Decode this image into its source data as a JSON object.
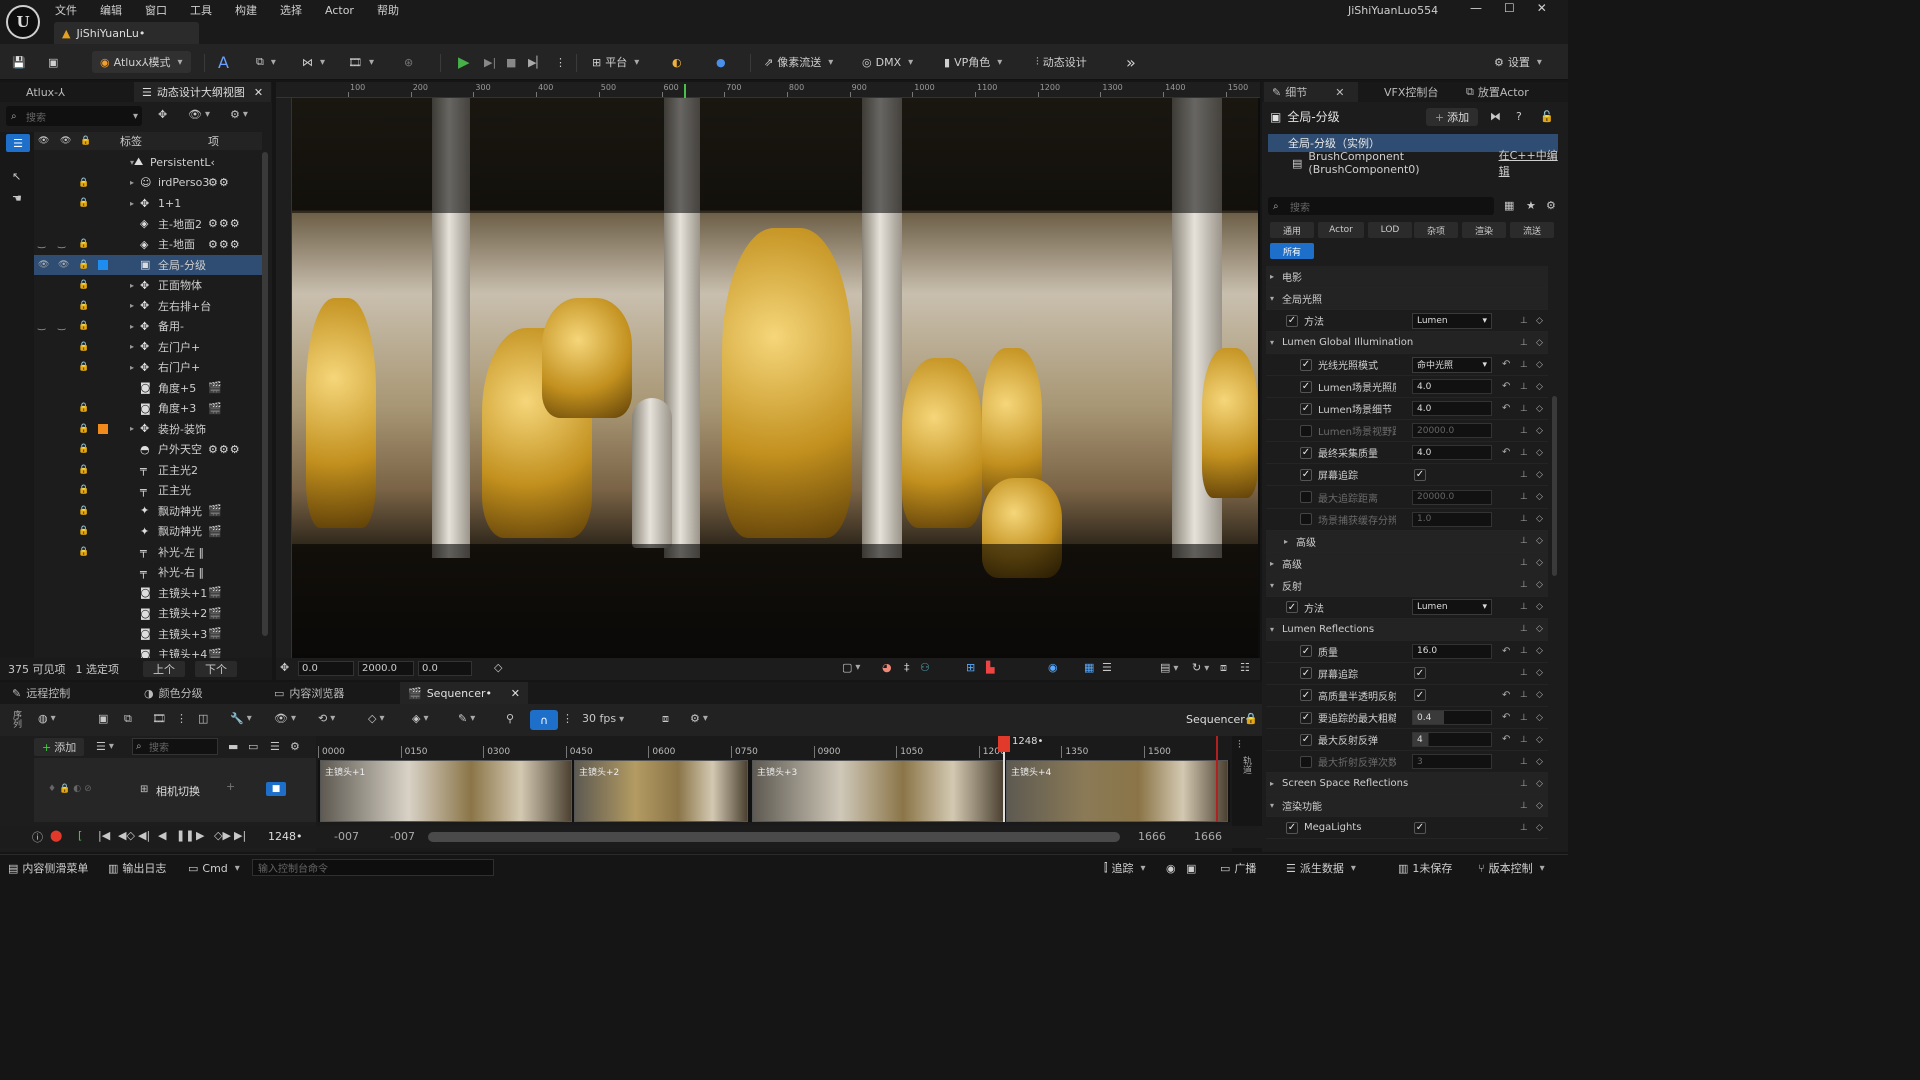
{
  "menu": [
    "文件",
    "编辑",
    "窗口",
    "工具",
    "构建",
    "选择",
    "Actor",
    "帮助"
  ],
  "doc_tab": "JiShiYuanLu•",
  "user_name": "JiShiYuanLuo554",
  "toolbar": {
    "mode": "Atlux⅄模式",
    "platform": "平台",
    "pixel_streaming": "像素流送",
    "dmx": "DMX",
    "vp_role": "VP角色",
    "motion_design": "动态设计",
    "settings": "设置"
  },
  "left_panel": {
    "tab1": "Atlux-⅄",
    "tab2": "动态设计大纲视图",
    "search_placeholder": "搜索",
    "col_label": "标签",
    "col_item": "项",
    "rows": [
      {
        "label": "PersistentL‹",
        "icon": "level",
        "lock": false,
        "arrow": "▾"
      },
      {
        "label": "irdPerso3",
        "icon": "person",
        "lock": true,
        "arrow": "▸",
        "extra": "⚙⚙"
      },
      {
        "label": "1+1",
        "icon": "move",
        "lock": true,
        "arrow": "▸"
      },
      {
        "label": "主-地面2",
        "icon": "cube",
        "lock": false,
        "arrow": "",
        "extra": "⚙⚙⚙"
      },
      {
        "label": "主-地面",
        "icon": "cube",
        "lock": true,
        "arrow": "",
        "extra": "⚙⚙⚙",
        "eyes": true
      },
      {
        "label": "全局-分级",
        "icon": "grade",
        "lock": true,
        "arrow": "",
        "selected": true,
        "mark": "#1d8ef0",
        "eyes": true
      },
      {
        "label": "正面物体",
        "icon": "move",
        "lock": true,
        "arrow": "▸"
      },
      {
        "label": "左右排+台",
        "icon": "move",
        "lock": true,
        "arrow": "▸"
      },
      {
        "label": "备用-",
        "icon": "move",
        "lock": true,
        "arrow": "▸",
        "eyes": true
      },
      {
        "label": "左门户+",
        "icon": "move",
        "lock": true,
        "arrow": "▸"
      },
      {
        "label": "右门户+",
        "icon": "move",
        "lock": true,
        "arrow": "▸"
      },
      {
        "label": "角度+5",
        "icon": "camera",
        "lock": false,
        "arrow": "",
        "extra": "🎬"
      },
      {
        "label": "角度+3",
        "icon": "camera",
        "lock": true,
        "arrow": "",
        "extra": "🎬"
      },
      {
        "label": "装扮-装饰",
        "icon": "move",
        "lock": true,
        "arrow": "▸",
        "mark": "#f08a1d"
      },
      {
        "label": "户外天空",
        "icon": "sky",
        "lock": true,
        "arrow": "",
        "extra": "⚙⚙⚙"
      },
      {
        "label": "正主光2",
        "icon": "light",
        "lock": true,
        "arrow": ""
      },
      {
        "label": "正主光",
        "icon": "light",
        "lock": true,
        "arrow": ""
      },
      {
        "label": "飘动神光",
        "icon": "spot",
        "lock": true,
        "arrow": "",
        "extra": "🎬"
      },
      {
        "label": "飘动神光",
        "icon": "spot",
        "lock": true,
        "arrow": "",
        "extra": "🎬"
      },
      {
        "label": "补光-左 ‖",
        "icon": "light",
        "lock": true,
        "arrow": ""
      },
      {
        "label": "补光-右 ‖",
        "icon": "light",
        "lock": false,
        "arrow": ""
      },
      {
        "label": "主镜头+1",
        "icon": "camera",
        "lock": false,
        "arrow": "",
        "extra": "🎬"
      },
      {
        "label": "主镜头+2",
        "icon": "camera",
        "lock": false,
        "arrow": "",
        "extra": "🎬"
      },
      {
        "label": "主镜头+3",
        "icon": "camera",
        "lock": false,
        "arrow": "",
        "extra": "🎬"
      },
      {
        "label": "主镜头+4",
        "icon": "camera",
        "lock": false,
        "arrow": "",
        "extra": "🎬"
      }
    ],
    "footer_count": "375 可见项",
    "footer_selected": "1 选定项",
    "btn_up": "上个",
    "btn_down": "下个"
  },
  "viewport": {
    "ruler_ticks": [
      "100",
      "200",
      "300",
      "400",
      "500",
      "600",
      "700",
      "800",
      "900",
      "1000",
      "1100",
      "1200",
      "1300",
      "1400",
      "1500"
    ],
    "field1": "0.0",
    "field2": "2000.0",
    "field3": "0.0"
  },
  "details": {
    "tab_details": "细节",
    "tab_vfx": "VFX控制台",
    "tab_place": "放置Actor",
    "title": "全局-分级",
    "add_label": "添加",
    "component_selected": "全局-分级（实例）",
    "component_child": "BrushComponent (BrushComponent0)",
    "edit_cpp": "在C++中编辑",
    "search_placeholder": "搜索",
    "categories": [
      "通用",
      "Actor",
      "LOD",
      "杂项",
      "渲染",
      "流送",
      "所有"
    ],
    "rows": [
      {
        "type": "section",
        "label": "电影",
        "open": false
      },
      {
        "type": "section",
        "label": "全局光照",
        "open": true
      },
      {
        "type": "dropdown",
        "label": "方法",
        "value": "Lumen",
        "checked": true,
        "indent": 1
      },
      {
        "type": "section",
        "label": "Lumen Global Illumination",
        "open": true
      },
      {
        "type": "dropdown",
        "label": "光线光照模式",
        "value": "命中光照",
        "checked": true,
        "indent": 2,
        "reset": true
      },
      {
        "type": "value",
        "label": "Lumen场景光照质量",
        "value": "4.0",
        "checked": true,
        "indent": 2,
        "reset": true
      },
      {
        "type": "value",
        "label": "Lumen场景细节",
        "value": "4.0",
        "checked": true,
        "indent": 2,
        "reset": true
      },
      {
        "type": "value",
        "label": "Lumen场景视野距离",
        "value": "20000.0",
        "checked": false,
        "indent": 2,
        "disabled": true
      },
      {
        "type": "value",
        "label": "最终采集质量",
        "value": "4.0",
        "checked": true,
        "indent": 2,
        "reset": true
      },
      {
        "type": "check",
        "label": "屏幕追踪",
        "checked": true,
        "indent": 2
      },
      {
        "type": "value",
        "label": "最大追踪距离",
        "value": "20000.0",
        "checked": false,
        "indent": 2,
        "disabled": true
      },
      {
        "type": "value",
        "label": "场景捕获缓存分辨率...",
        "value": "1.0",
        "checked": false,
        "indent": 2,
        "disabled": true
      },
      {
        "type": "section",
        "label": "高级",
        "open": false,
        "indent": 1
      },
      {
        "type": "section",
        "label": "高级",
        "open": false
      },
      {
        "type": "section",
        "label": "反射",
        "open": true
      },
      {
        "type": "dropdown",
        "label": "方法",
        "value": "Lumen",
        "checked": true,
        "indent": 1
      },
      {
        "type": "section",
        "label": "Lumen Reflections",
        "open": true
      },
      {
        "type": "value",
        "label": "质量",
        "value": "16.0",
        "checked": true,
        "indent": 2,
        "reset": true
      },
      {
        "type": "check",
        "label": "屏幕追踪",
        "checked": true,
        "indent": 2
      },
      {
        "type": "check",
        "label": "高质量半透明反射",
        "checked": true,
        "indent": 2,
        "reset": true
      },
      {
        "type": "value",
        "label": "要追踪的最大粗糙度",
        "value": "0.4",
        "checked": true,
        "indent": 2,
        "reset": true,
        "fill": 0.4
      },
      {
        "type": "value",
        "label": "最大反射反弹",
        "value": "4",
        "checked": true,
        "indent": 2,
        "reset": true,
        "fill": 0.2
      },
      {
        "type": "value",
        "label": "最大折射反弹次数",
        "value": "3",
        "checked": false,
        "indent": 2,
        "disabled": true
      },
      {
        "type": "section",
        "label": "Screen Space Reflections",
        "open": false
      },
      {
        "type": "section",
        "label": "渲染功能",
        "open": true
      },
      {
        "type": "check",
        "label": "MegaLights",
        "checked": true,
        "indent": 1
      }
    ]
  },
  "bottom": {
    "tabs": [
      "远程控制",
      "颜色分级",
      "内容浏览器",
      "Sequencer•"
    ],
    "fps": "30 fps",
    "seq_name": "Sequencer•",
    "add": "添加",
    "search_placeholder": "搜索",
    "track_label": "相机切换",
    "ruler": [
      "0000",
      "0150",
      "0300",
      "0450",
      "0600",
      "0750",
      "0900",
      "1050",
      "1200",
      "1350",
      "1500"
    ],
    "playhead": "1248•",
    "clips": [
      {
        "title": "主镜头+1",
        "colorA": "#d8d2c6"
      },
      {
        "title": "主镜头+2",
        "colorA": "#b39b62"
      },
      {
        "title": "主镜头+3",
        "colorA": "#cfc8b9"
      },
      {
        "title": "主镜头+4",
        "colorA": "#8a7a56"
      }
    ],
    "frame_current": "1248•",
    "in_a": "-007",
    "in_b": "-007",
    "out_a": "1666",
    "out_b": "1666",
    "side_label": "序列"
  },
  "status": {
    "drawer": "内容侧滑菜单",
    "log": "输出日志",
    "cmd": "Cmd",
    "cmd_placeholder": "输入控制台命令",
    "trace": "追踪",
    "broadcast": "广播",
    "derived": "派生数据",
    "unsaved": "1未保存",
    "source_control": "版本控制"
  }
}
